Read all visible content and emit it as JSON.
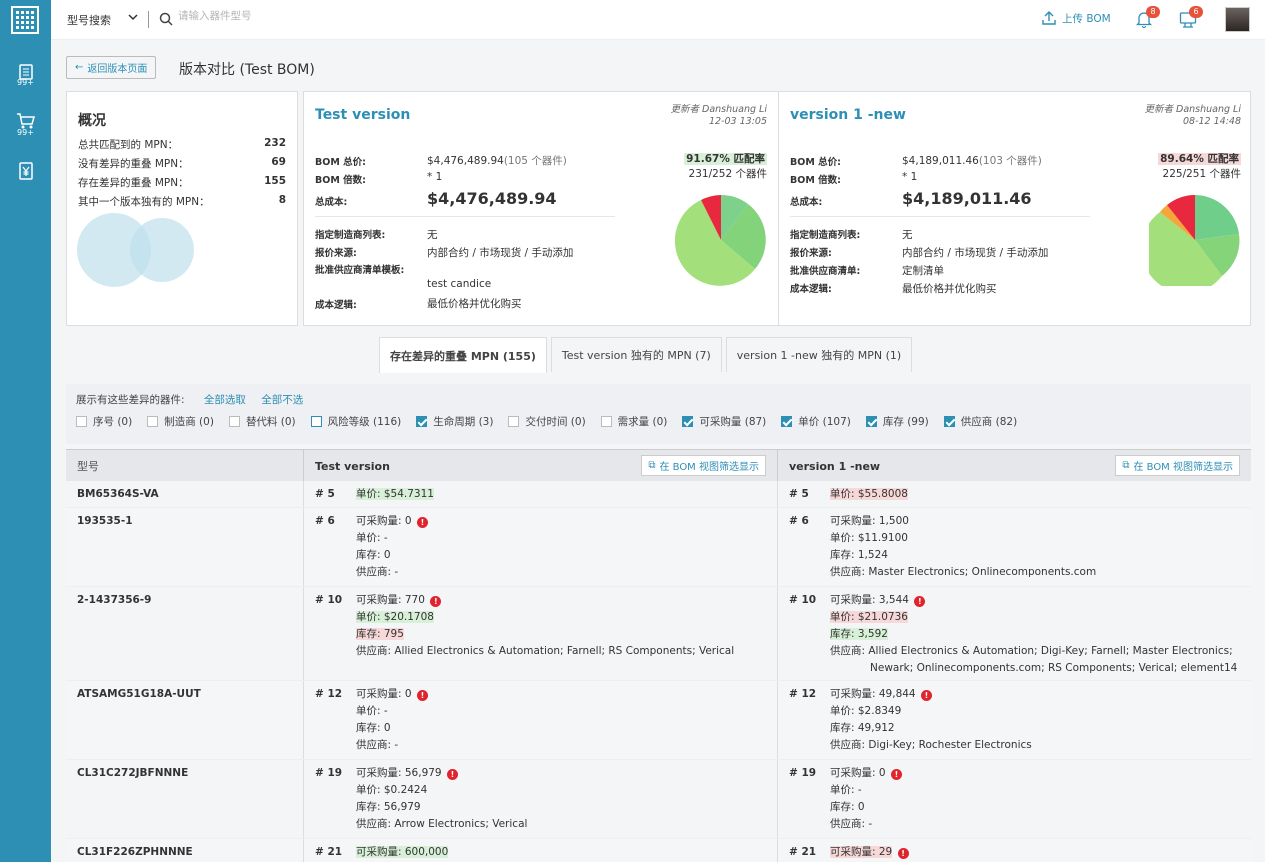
{
  "topbar": {
    "search_type": "型号搜索",
    "search_placeholder": "请输入器件型号",
    "upload_label": "上传 BOM",
    "notif_count": "8",
    "msg_count": "6"
  },
  "rail": {
    "item1_count": "99+",
    "item2_count": "99+"
  },
  "page": {
    "back_label": "返回版本页面",
    "title": "版本对比 (Test BOM)"
  },
  "summary": {
    "title": "概况",
    "rows": [
      {
        "label": "总共匹配到的 MPN：",
        "value": "232"
      },
      {
        "label": "没有差异的重叠 MPN：",
        "value": "69"
      },
      {
        "label": "存在差异的重叠 MPN：",
        "value": "155"
      },
      {
        "label": "其中一个版本独有的 MPN：",
        "value": "8"
      }
    ]
  },
  "versions": [
    {
      "name": "Test version",
      "updater": "更新者 Danshuang Li",
      "updated": "12-03 13:05",
      "bom_total_label": "BOM 总价:",
      "bom_total": "$4,476,489.94",
      "bom_total_sub": "(105 个器件)",
      "multiplier_label": "BOM 倍数:",
      "multiplier": "* 1",
      "cost_label": "总成本:",
      "cost": "$4,476,489.94",
      "mfr_list_label": "指定制造商列表:",
      "mfr_list": "无",
      "quote_src_label": "报价来源:",
      "quote_src": "内部合约 / 市场现货 / 手动添加",
      "vendor_label": "批准供应商清单模板:",
      "vendor": "test candice",
      "logic_label": "成本逻辑:",
      "logic": "最低价格并优化购买",
      "match_pct": "91.67% 匹配率",
      "match_count": "231/252 个器件"
    },
    {
      "name": "version 1 -new",
      "updater": "更新者 Danshuang Li",
      "updated": "08-12 14:48",
      "bom_total_label": "BOM 总价:",
      "bom_total": "$4,189,011.46",
      "bom_total_sub": "(103 个器件)",
      "multiplier_label": "BOM 倍数:",
      "multiplier": "* 1",
      "cost_label": "总成本:",
      "cost": "$4,189,011.46",
      "mfr_list_label": "指定制造商列表:",
      "mfr_list": "无",
      "quote_src_label": "报价来源:",
      "quote_src": "内部合约 / 市场现货 / 手动添加",
      "vendor_label": "批准供应商清单:",
      "vendor": "定制清单",
      "logic_label": "成本逻辑:",
      "logic": "最低价格并优化购买",
      "match_pct": "89.64% 匹配率",
      "match_count": "225/251 个器件"
    }
  ],
  "tabs": [
    "存在差异的重叠 MPN (155)",
    "Test version 独有的 MPN (7)",
    "version 1 -new 独有的 MPN (1)"
  ],
  "filters": {
    "header": "展示有这些差异的器件:",
    "select_all": "全部选取",
    "select_none": "全部不选",
    "items": [
      {
        "label": "序号 (0)",
        "checked": false
      },
      {
        "label": "制造商 (0)",
        "checked": false
      },
      {
        "label": "替代料 (0)",
        "checked": false
      },
      {
        "label": "风险等级 (116)",
        "checked": false
      },
      {
        "label": "生命周期 (3)",
        "checked": true
      },
      {
        "label": "交付时间 (0)",
        "checked": false
      },
      {
        "label": "需求量 (0)",
        "checked": false
      },
      {
        "label": "可采购量 (87)",
        "checked": true
      },
      {
        "label": "单价 (107)",
        "checked": true
      },
      {
        "label": "库存 (99)",
        "checked": true
      },
      {
        "label": "供应商 (82)",
        "checked": true
      }
    ]
  },
  "table": {
    "col_mpn": "型号",
    "col_a": "Test version",
    "col_b": "version 1 -new",
    "bom_link": "在 BOM 视图筛选显示",
    "rows": [
      {
        "mpn": "BM65364S-VA",
        "a_num": "# 5",
        "b_num": "# 5",
        "a_line1": "单价: $54.7311",
        "b_line1": "单价: $55.8008"
      },
      {
        "mpn": "193535-1",
        "a_num": "# 6",
        "b_num": "# 6",
        "a": [
          "可采购量: 0",
          "单价: -",
          "库存: 0",
          "供应商: -"
        ],
        "b": [
          "可采购量: 1,500",
          "单价: $11.9100",
          "库存: 1,524",
          "供应商: Master Electronics; Onlinecomponents.com"
        ]
      },
      {
        "mpn": "2-1437356-9",
        "a_num": "# 10",
        "b_num": "# 10",
        "a": [
          "可采购量: 770",
          "单价: $20.1708",
          "库存: 795",
          "供应商: Allied Electronics & Automation; Farnell; RS Components; Verical"
        ],
        "b": [
          "可采购量: 3,544",
          "单价: $21.0736",
          "库存: 3,592",
          "供应商: Allied Electronics & Automation; Digi-Key; Farnell; Master Electronics;",
          "Newark; Onlinecomponents.com; RS Components; Verical; element14"
        ]
      },
      {
        "mpn": "ATSAMG51G18A-UUT",
        "a_num": "# 12",
        "b_num": "# 12",
        "a": [
          "可采购量: 0",
          "单价: -",
          "库存: 0",
          "供应商: -"
        ],
        "b": [
          "可采购量: 49,844",
          "单价: $2.8349",
          "库存: 49,912",
          "供应商: Digi-Key; Rochester Electronics"
        ]
      },
      {
        "mpn": "CL31C272JBFNNNE",
        "a_num": "# 19",
        "b_num": "# 19",
        "a": [
          "可采购量: 56,979",
          "单价: $0.2424",
          "库存: 56,979",
          "供应商: Arrow Electronics; Verical"
        ],
        "b": [
          "可采购量: 0",
          "单价: -",
          "库存: 0",
          "供应商: -"
        ]
      },
      {
        "mpn": "CL31F226ZPHNNNE",
        "a_num": "# 21",
        "b_num": "# 21",
        "a_line1": "可采购量: 600,000",
        "b_line1": "可采购量: 29"
      }
    ]
  },
  "colors": {
    "accent": "#2e8fb4",
    "green_hl": "#d8f0d8",
    "red_hl": "#f7d8d8",
    "warn": "#e0242e"
  }
}
